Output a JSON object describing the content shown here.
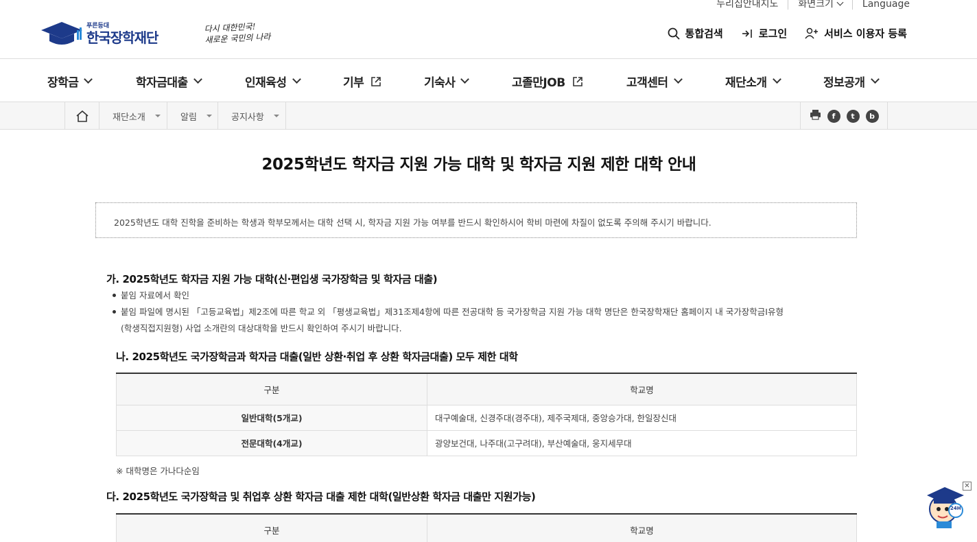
{
  "utility": {
    "accessibility": "누리집안내지도",
    "font_size": "화면크기",
    "language": "Language"
  },
  "brand": {
    "tagline": "푸른등대",
    "name": "한국장학재단",
    "slogan_line1": "다시 대한민국!",
    "slogan_line2": "새로운 국민의 나라"
  },
  "header_actions": {
    "search": "통합검색",
    "login": "로그인",
    "register": "서비스 이용자 등록"
  },
  "gnb": [
    "장학금",
    "학자금대출",
    "인재육성",
    "기부",
    "기숙사",
    "고졸만JOB",
    "고객센터",
    "재단소개",
    "정보공개"
  ],
  "breadcrumb": [
    "재단소개",
    "알림",
    "공지사항"
  ],
  "share": {
    "facebook": "f",
    "twitter": "t",
    "blog": "b"
  },
  "page_title": "2025학년도 학자금 지원 가능 대학 및 학자금 지원 제한 대학 안내",
  "notice_text": "2025학년도 대학 진학을 준비하는 학생과 학부모께서는 대학 선택 시, 학자금 지원 가능 여부를 반드시 확인하시어 학비 마련에 차질이 없도록 주의해 주시기 바랍니다.",
  "section_a": {
    "heading": "가. 2025학년도 학자금 지원 가능 대학(신·편입생 국가장학금 및 학자금 대출)",
    "bullet1": "붙임 자료에서 확인",
    "bullet2_line1": "붙임 파일에 명시된 「고등교육법」제2조에 따른 학교 외 「평생교육법」제31조제4항에 따른 전공대학 등 국가장학금 지원 가능 대학 명단은 한국장학재단 홈페이지 내 국가장학금Ⅰ유형",
    "bullet2_line2": "(학생직접지원형) 사업 소개란의 대상대학을 반드시 확인하여 주시기 바랍니다."
  },
  "section_b": {
    "heading": "나. 2025학년도 국가장학금과 학자금 대출(일반 상환·취업 후 상환 학자금대출) 모두 제한 대학",
    "col1": "구분",
    "col2": "학교명",
    "rows": [
      {
        "type": "일반대학(5개교)",
        "schools": "대구예술대, 신경주대(경주대), 제주국제대, 중앙승가대, 한일장신대"
      },
      {
        "type": "전문대학(4개교)",
        "schools": "광양보건대, 나주대(고구려대), 부산예술대, 웅지세무대"
      }
    ],
    "note": "※ 대학명은 가나다순임"
  },
  "section_c": {
    "heading": "다. 2025학년도 국가장학금 및 취업후 상환 학자금 대출 제한 대학(일반상환 학자금 대출만 지원가능)",
    "col1": "구분",
    "col2": "학교명"
  },
  "chatbot": {
    "badge": "24H",
    "close": "✕"
  },
  "colors": {
    "brand_blue": "#1d3a8a",
    "accent_sky": "#2a8ad8"
  }
}
